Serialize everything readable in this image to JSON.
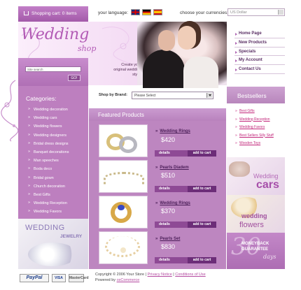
{
  "topbar": {
    "cart_label": "Shopping cart: 0 items",
    "language_label": "your language:",
    "flags": [
      "english-flag",
      "german-flag",
      "spanish-flag"
    ],
    "currency_label": "choose your currencies:",
    "currency_value": "US Dollar"
  },
  "header": {
    "logo": "Wedding",
    "logo_sub": "shop",
    "tagline_1": "Create your",
    "tagline_2": "original wedding",
    "tagline_3": "style!"
  },
  "right_nav": [
    {
      "label": "Home Page"
    },
    {
      "label": "New Products"
    },
    {
      "label": "Specials"
    },
    {
      "label": "My Account"
    },
    {
      "label": "Contact Us"
    }
  ],
  "search": {
    "placeholder": "Site search",
    "go_label": "GO!"
  },
  "categories": {
    "title": "Categories:",
    "items": [
      "Wedding decoration",
      "Wedding cars",
      "Wedding flowers",
      "Wedding designers",
      "Bridal dress designs",
      "Banquet decorations",
      "Man speeches",
      "Boda deco",
      "Bridal gown",
      "Church decoration",
      "Best Gifts",
      "Wedding Reception",
      "Wedding Favors"
    ]
  },
  "jewelry_banner": {
    "line1": "WEDDING",
    "line2": "JEWELRY"
  },
  "brand_filter": {
    "label": "Shop by Brand:",
    "value": "Please Select"
  },
  "featured": {
    "title": "Featured Products",
    "details_label": "details",
    "add_label": "add to cart",
    "products": [
      {
        "name": "Wedding Rings",
        "price": "$420"
      },
      {
        "name": "Pearls Diadem",
        "price": "$510"
      },
      {
        "name": "Wedding Rings",
        "price": "$370"
      },
      {
        "name": "Pearls Set",
        "price": "$830"
      }
    ]
  },
  "bestsellers": {
    "title": "Bestsellers",
    "items": [
      "Best Gifts",
      "Wedding Reception",
      "Wedding Favors",
      "Best Sellers Silly Stuff",
      "Wooden Toys"
    ]
  },
  "banners": {
    "cars_1": "Wedding",
    "cars_2": "cars",
    "flowers_1": "wedding",
    "flowers_2": "flowers",
    "money_big": "30",
    "money_1": "MONEYBACK",
    "money_2": "GUARANTEE",
    "money_3": "days"
  },
  "footer": {
    "paypal": "PayPal",
    "visa": "VISA",
    "mastercard": "MasterCard",
    "copyright": "Copyright © 2006 Your Store",
    "sep": "|",
    "privacy": "Privacy Notice",
    "conditions": "Conditions of Use",
    "powered_by": "Powered by",
    "oscommerce": "osCommerce"
  },
  "colors": {
    "brand_purple": "#bd7fbf",
    "accent_link": "#c2267a",
    "button_dark": "#6c2d78"
  }
}
